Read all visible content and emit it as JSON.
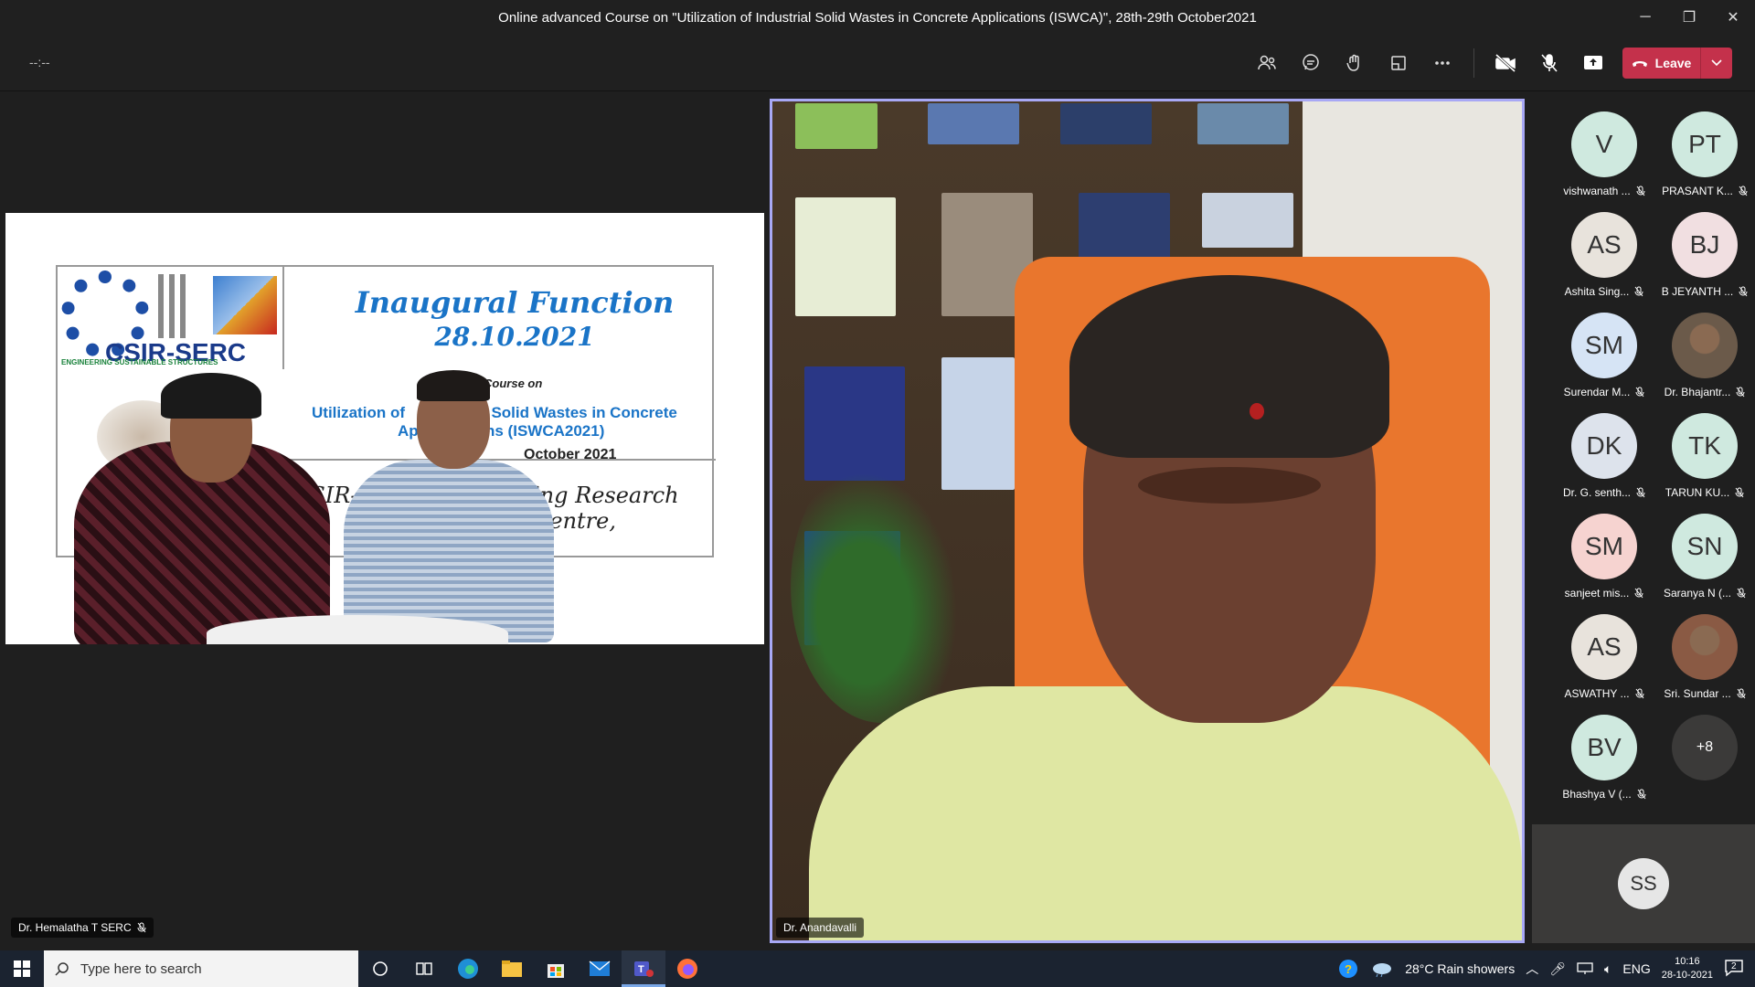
{
  "window": {
    "title": "Online advanced Course on \"Utilization of Industrial Solid Wastes in Concrete Applications (ISWCA)\", 28th-29th October2021",
    "controls": [
      "minimize-icon",
      "restore-icon",
      "close-icon"
    ]
  },
  "toolbar": {
    "timer": "--:--",
    "icons": [
      "participants-icon",
      "chat-icon",
      "reactions-icon",
      "rooms-icon",
      "more-icon",
      "camera-off-icon",
      "mic-off-icon",
      "share-icon"
    ],
    "leave_label": "Leave"
  },
  "shared_content": {
    "presenter_name": "Dr. Hemalatha T SERC",
    "slide": {
      "logo_text": "CSIR-SERC",
      "logo_tagline": "ENGINEERING SUSTAINABLE STRUCTURES",
      "heading": "Inaugural Function",
      "date": "28.10.2021",
      "course_fragment": "ced Course on",
      "title_line1": "Utilization of",
      "title_line1b": "l Solid Wastes in Concrete",
      "title_line2": "Appl",
      "title_line2b": "ns (ISWCA2021)",
      "dates_fragment": "October 2021",
      "centre_fragment1": "CSIR-St",
      "centre_fragment2": "ing Research Centre,"
    }
  },
  "main_speaker": {
    "name": "Dr. Anandavalli"
  },
  "participants": [
    {
      "initials": "V",
      "name": "vishwanath ...",
      "color": "#cfe9df"
    },
    {
      "initials": "PT",
      "name": "PRASANT K...",
      "color": "#cfe9df"
    },
    {
      "initials": "AS",
      "name": "Ashita Sing...",
      "color": "#e8e3dc"
    },
    {
      "initials": "BJ",
      "name": "B JEYANTH ...",
      "color": "#f1dfe1"
    },
    {
      "initials": "SM",
      "name": "Surendar M...",
      "color": "#d6e4f5"
    },
    {
      "initials": "",
      "name": "Dr. Bhajantr...",
      "color": "#6b5a4a"
    },
    {
      "initials": "DK",
      "name": "Dr. G. senth...",
      "color": "#dde3ec"
    },
    {
      "initials": "TK",
      "name": "TARUN KU...",
      "color": "#cfe9df"
    },
    {
      "initials": "SM",
      "name": "sanjeet mis...",
      "color": "#f6d3d0"
    },
    {
      "initials": "SN",
      "name": "Saranya N (...",
      "color": "#cfe9df"
    },
    {
      "initials": "AS",
      "name": "ASWATHY ...",
      "color": "#e8e3dc"
    },
    {
      "initials": "",
      "name": "Sri. Sundar ...",
      "color": "#8a5a44"
    },
    {
      "initials": "BV",
      "name": "Bhashya V (...",
      "color": "#cfe9df"
    },
    {
      "initials": "+8",
      "name": "",
      "color": "#3b3a39"
    }
  ],
  "self_view": {
    "initials": "SS"
  },
  "taskbar": {
    "search_placeholder": "Type here to search",
    "weather": "28°C  Rain showers",
    "language": "ENG",
    "time": "10:16",
    "date": "28-10-2021",
    "notifications": "2"
  }
}
